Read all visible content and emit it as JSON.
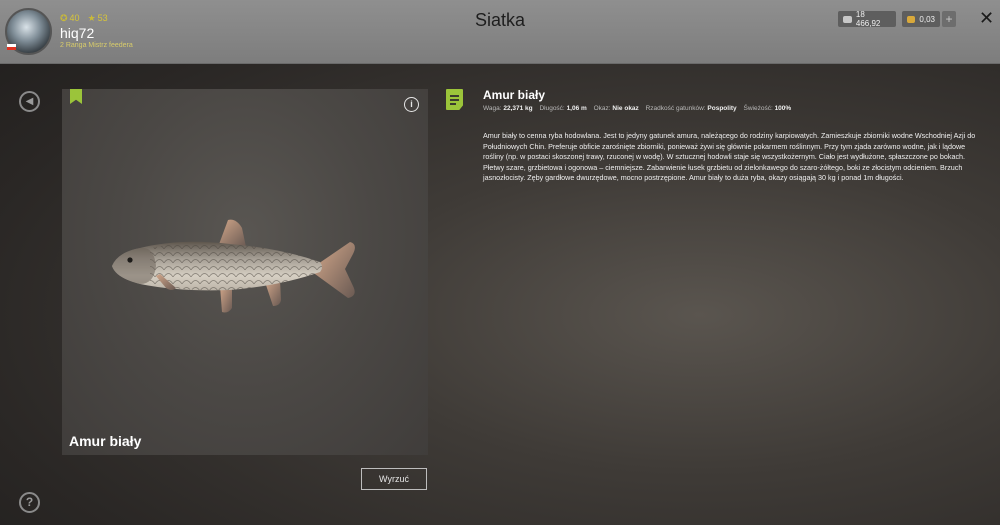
{
  "header": {
    "title": "Siatka",
    "player": {
      "name": "hiq72",
      "rank": "2 Ranga Mistrz feedera",
      "level_xp": "40",
      "stars": "53"
    },
    "currency": {
      "silver": "18 466,92",
      "gold": "0,03",
      "plus_label": "+"
    },
    "close_label": "✕"
  },
  "nav": {
    "back_label": "◀",
    "help_label": "?"
  },
  "fish": {
    "name": "Amur biały",
    "info_label": "i",
    "discard_label": "Wyrzuć"
  },
  "details": {
    "title": "Amur biały",
    "props": [
      {
        "label": "Waga:",
        "value": "22,371 kg"
      },
      {
        "label": "Długość:",
        "value": "1,06 m"
      },
      {
        "label": "Okaz:",
        "value": "Nie okaz"
      },
      {
        "label": "Rzadkość gatunków:",
        "value": "Pospolity"
      },
      {
        "label": "Świeżość:",
        "value": "100%"
      }
    ],
    "description": "Amur biały to cenna ryba hodowlana. Jest to jedyny gatunek amura, należącego do rodziny karpiowatych. Zamieszkuje zbiorniki wodne Wschodniej Azji do Południowych Chin. Preferuje obficie zarośnięte zbiorniki, ponieważ żywi się głównie pokarmem roślinnym. Przy tym zjada zarówno wodne, jak i lądowe rośliny (np. w postaci skoszonej trawy, rzuconej w wodę). W sztucznej hodowli staje się wszystkożernym. Ciało jest wydłużone, spłaszczone po bokach. Płetwy szare, grzbietowa i ogonowa – ciemniejsze. Zabarwienie łusek grzbietu od zielonkawego do szaro-żółtego, boki ze złocistym odcieniem. Brzuch jasnozłocisty. Zęby gardłowe dwurzędowe, mocno postrzępione. Amur biały to duża ryba, okazy osiągają 30 kg i ponad 1m długości."
  },
  "colors": {
    "accent": "#9bc43a",
    "topbar": "#8a8a8a"
  }
}
